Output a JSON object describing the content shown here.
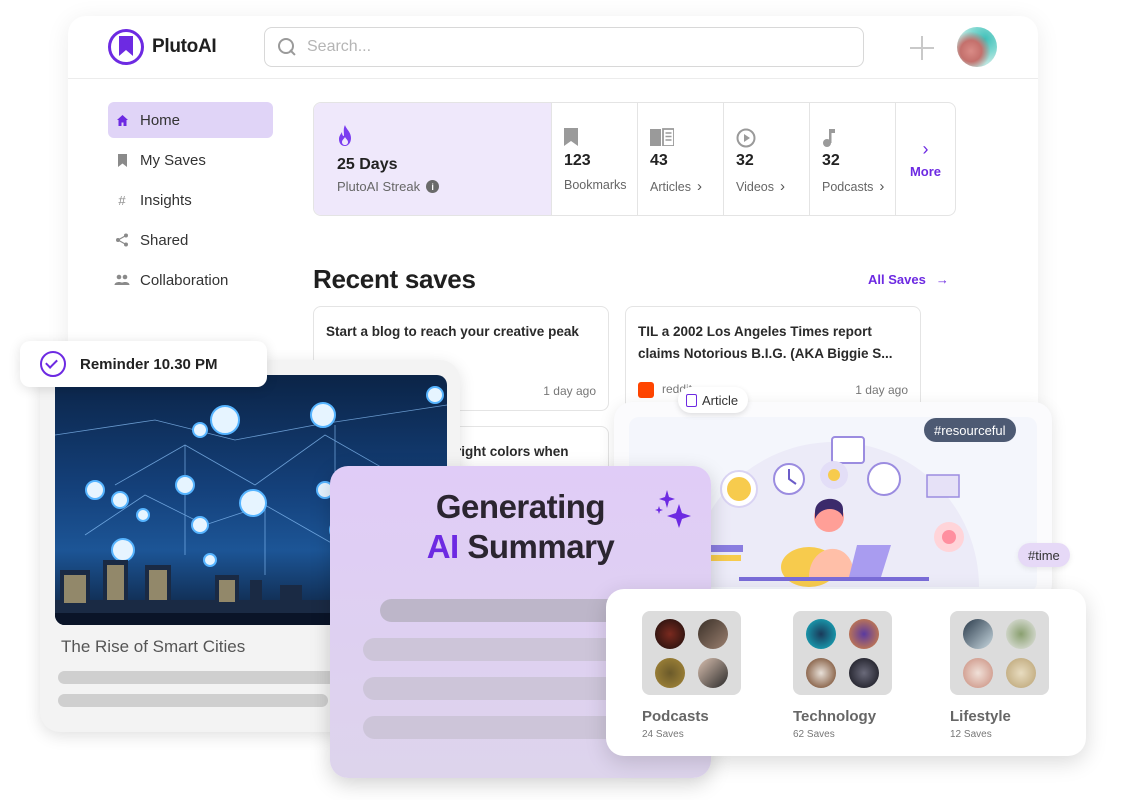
{
  "app": {
    "brand": "PlutoAI",
    "search_placeholder": "Search...",
    "add_label": "+"
  },
  "sidebar": {
    "items": [
      {
        "label": "Home",
        "icon": "home-icon",
        "active": true
      },
      {
        "label": "My Saves",
        "icon": "bookmark-icon"
      },
      {
        "label": "Insights",
        "icon": "hash-icon"
      },
      {
        "label": "Shared",
        "icon": "share-icon"
      },
      {
        "label": "Collaboration",
        "icon": "people-icon"
      }
    ]
  },
  "stats": {
    "streak": {
      "value": "25 Days",
      "label": "PlutoAI Streak",
      "info": "i"
    },
    "items": [
      {
        "value": "123",
        "label": "Bookmarks",
        "icon": "bookmark-icon"
      },
      {
        "value": "43",
        "label": "Articles",
        "icon": "book-icon",
        "chevron": "›"
      },
      {
        "value": "32",
        "label": "Videos",
        "icon": "play-icon",
        "chevron": "›"
      },
      {
        "value": "32",
        "label": "Podcasts",
        "icon": "music-note-icon",
        "chevron": "›"
      }
    ],
    "more_label": "More",
    "more_chevron": "›"
  },
  "recent": {
    "title": "Recent saves",
    "all_saves_label": "All Saves",
    "all_saves_arrow": "→",
    "cards": [
      {
        "title": "Start a blog to reach your creative peak",
        "source": "",
        "time": "1 day ago"
      },
      {
        "title": "TIL a 2002 Los Angeles Times report claims Notorious B.I.G. (AKA Biggie S...",
        "source": "reddit",
        "time": "1 day ago"
      },
      {
        "title": "right colors when"
      }
    ]
  },
  "overlays": {
    "reminder": "Reminder 10.30 PM",
    "city_title": "The Rise of Smart Cities",
    "ai_line1": "Generating",
    "ai_accent": "AI",
    "ai_rest": "Summary",
    "tag_article": "Article",
    "tag_resourceful": "#resourceful",
    "tag_time": "#time"
  },
  "categories": [
    {
      "name": "Podcasts",
      "count": "24 Saves"
    },
    {
      "name": "Technology",
      "count": "62 Saves"
    },
    {
      "name": "Lifestyle",
      "count": "12 Saves"
    }
  ],
  "colors": {
    "accent": "#6d2ae2",
    "active_bg": "#e0d4f7",
    "streak_bg": "#efe8fb",
    "tag_dark": "#4d5a73"
  }
}
